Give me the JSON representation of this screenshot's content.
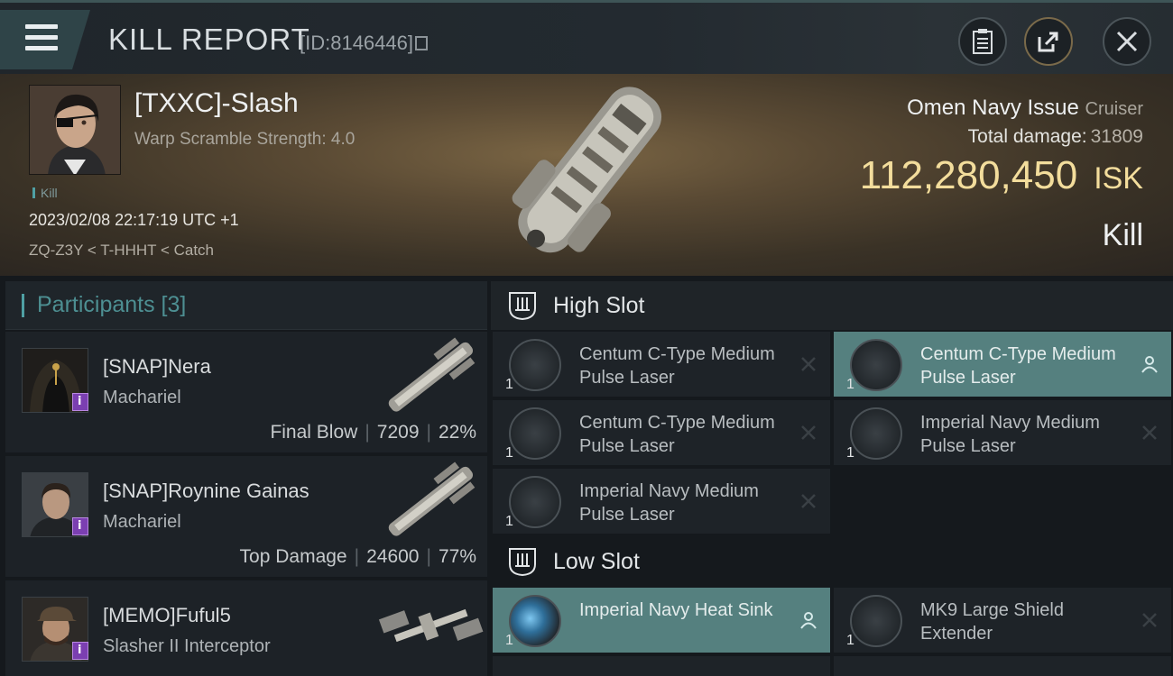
{
  "header": {
    "title": "KILL REPORT",
    "report_id": "[ID:8146446]"
  },
  "victim": {
    "name": "[TXXC]-Slash",
    "subtitle": "Warp Scramble Strength: 4.0",
    "tag": "Kill",
    "datetime": "2023/02/08 22:17:19 UTC +1",
    "location": "ZQ-Z3Y < T-HHHT < Catch",
    "ship": "Omen Navy Issue",
    "ship_class": "Cruiser",
    "damage_label": "Total damage:",
    "damage_value": "31809",
    "isk_value": "112,280,450",
    "isk_unit": "ISK",
    "kill_type": "Kill"
  },
  "participants": {
    "title": "Participants [3]",
    "items": [
      {
        "name": "[SNAP]Nera",
        "ship": "Machariel",
        "role": "Final Blow",
        "damage": "7209",
        "percent": "22%"
      },
      {
        "name": "[SNAP]Roynine Gainas",
        "ship": "Machariel",
        "role": "Top Damage",
        "damage": "24600",
        "percent": "77%"
      },
      {
        "name": "[MEMO]Fuful5",
        "ship": "Slasher II Interceptor",
        "role": "",
        "damage": "",
        "percent": ""
      }
    ]
  },
  "slots": {
    "high": {
      "label": "High Slot",
      "modules": [
        {
          "name": "Centum C-Type Medium Pulse Laser",
          "qty": "1",
          "state": "destroyed"
        },
        {
          "name": "Centum C-Type Medium Pulse Laser",
          "qty": "1",
          "state": "dropped"
        },
        {
          "name": "Centum C-Type Medium Pulse Laser",
          "qty": "1",
          "state": "destroyed"
        },
        {
          "name": "Imperial Navy Medium Pulse Laser",
          "qty": "1",
          "state": "destroyed"
        },
        {
          "name": "Imperial Navy Medium Pulse Laser",
          "qty": "1",
          "state": "destroyed"
        }
      ]
    },
    "low": {
      "label": "Low Slot",
      "modules": [
        {
          "name": "Imperial Navy Heat Sink",
          "qty": "1",
          "state": "dropped"
        },
        {
          "name": "MK9 Large Shield Extender",
          "qty": "1",
          "state": "destroyed"
        }
      ]
    }
  },
  "colors": {
    "accent": "#4fa0a4",
    "isk": "#f3dd9c",
    "active_module": "#55807f"
  }
}
